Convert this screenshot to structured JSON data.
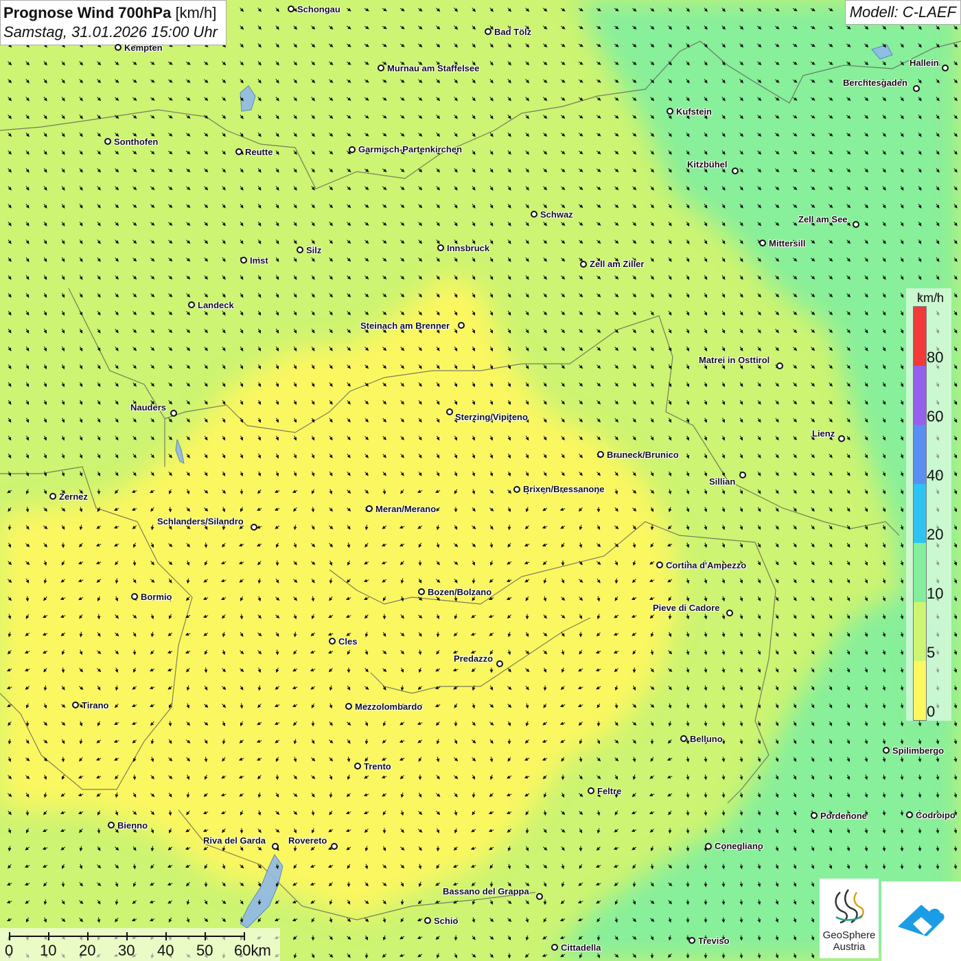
{
  "header": {
    "title_bold": "Prognose Wind 700hPa",
    "title_unit": "[km/h]",
    "subtitle": "Samstag, 31.01.2026 15:00 Uhr",
    "model": "Modell: C-LAEF"
  },
  "cities": [
    {
      "name": "Schongau"
    },
    {
      "name": "Bad Tölz"
    },
    {
      "name": "Kempten"
    },
    {
      "name": "Murnau am Staffelsee"
    },
    {
      "name": "Hallein"
    },
    {
      "name": "Berchtesgaden"
    },
    {
      "name": "Kufstein"
    },
    {
      "name": "Sonthofen"
    },
    {
      "name": "Reutte"
    },
    {
      "name": "Garmisch-Partenkirchen"
    },
    {
      "name": "Kitzbühel"
    },
    {
      "name": "Schwaz"
    },
    {
      "name": "Zell am See"
    },
    {
      "name": "Mittersill"
    },
    {
      "name": "Imst"
    },
    {
      "name": "Silz"
    },
    {
      "name": "Innsbruck"
    },
    {
      "name": "Zell am Ziller"
    },
    {
      "name": "Landeck"
    },
    {
      "name": "Steinach am Brenner"
    },
    {
      "name": "Matrei in Osttirol"
    },
    {
      "name": "Nauders"
    },
    {
      "name": "Sterzing/Vipiteno"
    },
    {
      "name": "Lienz"
    },
    {
      "name": "Bruneck/Brunico"
    },
    {
      "name": "Sillian"
    },
    {
      "name": "Brixen/Bressanone"
    },
    {
      "name": "Zernez"
    },
    {
      "name": "Meran/Merano"
    },
    {
      "name": "Schlanders/Silandro"
    },
    {
      "name": "Cortina d'Ampezzo"
    },
    {
      "name": "Bormio"
    },
    {
      "name": "Bozen/Bolzano"
    },
    {
      "name": "Pieve di Cadore"
    },
    {
      "name": "Cles"
    },
    {
      "name": "Predazzo"
    },
    {
      "name": "Tirano"
    },
    {
      "name": "Mezzolombardo"
    },
    {
      "name": "Belluno"
    },
    {
      "name": "Spilimbergo"
    },
    {
      "name": "Trento"
    },
    {
      "name": "Feltre"
    },
    {
      "name": "Bienno"
    },
    {
      "name": "Pordenone"
    },
    {
      "name": "Codroipo"
    },
    {
      "name": "Riva del Garda"
    },
    {
      "name": "Rovereto"
    },
    {
      "name": "Conegliano"
    },
    {
      "name": "Bassano del Grappa"
    },
    {
      "name": "Schio"
    },
    {
      "name": "Treviso"
    },
    {
      "name": "Cittadella"
    }
  ],
  "legend": {
    "unit": "km/h",
    "classes": [
      {
        "from": 0,
        "to": 5,
        "color": "#fdf760"
      },
      {
        "from": 5,
        "to": 10,
        "color": "#cdf472"
      },
      {
        "from": 10,
        "to": 20,
        "color": "#84ee9c"
      },
      {
        "from": 20,
        "to": 40,
        "color": "#2fc3f2"
      },
      {
        "from": 40,
        "to": 60,
        "color": "#5b8ef2"
      },
      {
        "from": 60,
        "to": 80,
        "color": "#9660ee"
      },
      {
        "from": 80,
        "to": null,
        "color": "#f23a3a"
      }
    ],
    "labels": [
      "80",
      "60",
      "40",
      "20",
      "10",
      "5",
      "0"
    ]
  },
  "scale_bar": {
    "labels": [
      "0",
      "10",
      "20",
      "30",
      "40",
      "50",
      "60km"
    ]
  },
  "logo": {
    "name_line1": "GeoSphere",
    "name_line2": "Austria"
  },
  "colors": {
    "wind_5_10": "#cdf472",
    "wind_0_5": "#fdf760",
    "wind_10_20": "#84ee9c",
    "arrow": "#111111"
  }
}
